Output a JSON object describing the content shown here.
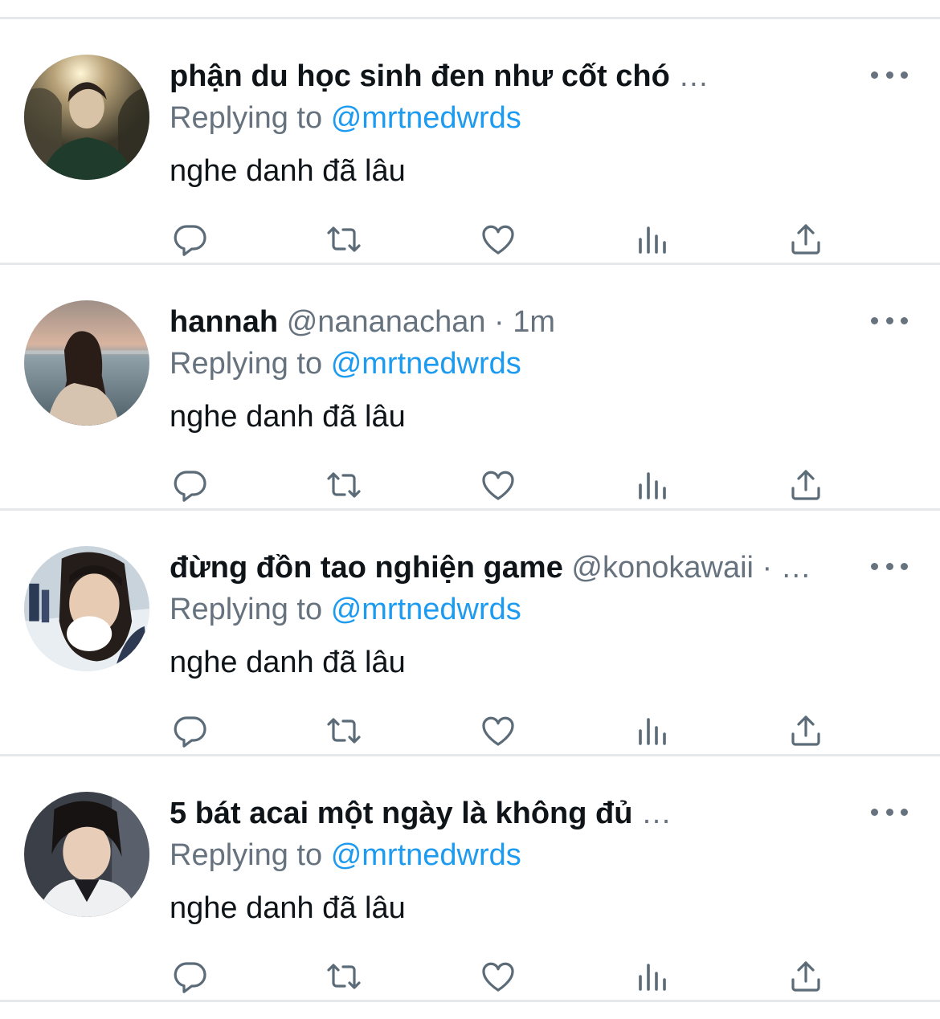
{
  "icons": {
    "more": "more-horizontal-icon",
    "reply": "reply-icon",
    "retweet": "retweet-icon",
    "like": "heart-icon",
    "views": "analytics-icon",
    "share": "share-icon"
  },
  "colors": {
    "text": "#0f1419",
    "secondary": "#66727e",
    "link": "#1d9bf0",
    "divider": "#e6e9ec"
  },
  "tweets": [
    {
      "name": "phận du học sinh đen như cốt chó",
      "handle": "",
      "separator": "",
      "time": "",
      "ellipsis": "…",
      "reply_prefix": "Replying to",
      "reply_to": "@mrtnedwrds",
      "text": "nghe danh đã lâu"
    },
    {
      "name": "hannah",
      "handle": "@nananachan",
      "separator": "·",
      "time": "1m",
      "ellipsis": "",
      "reply_prefix": "Replying to",
      "reply_to": "@mrtnedwrds",
      "text": "nghe danh đã lâu"
    },
    {
      "name": "đừng đồn tao nghiện game",
      "handle": "@konokawaii",
      "separator": "·",
      "time": "",
      "ellipsis": "…",
      "reply_prefix": "Replying to",
      "reply_to": "@mrtnedwrds",
      "text": "nghe danh đã lâu"
    },
    {
      "name": "5 bát acai một ngày là không đủ",
      "handle": "",
      "separator": "",
      "time": "",
      "ellipsis": "…",
      "reply_prefix": "Replying to",
      "reply_to": "@mrtnedwrds",
      "text": "nghe danh đã lâu"
    }
  ]
}
